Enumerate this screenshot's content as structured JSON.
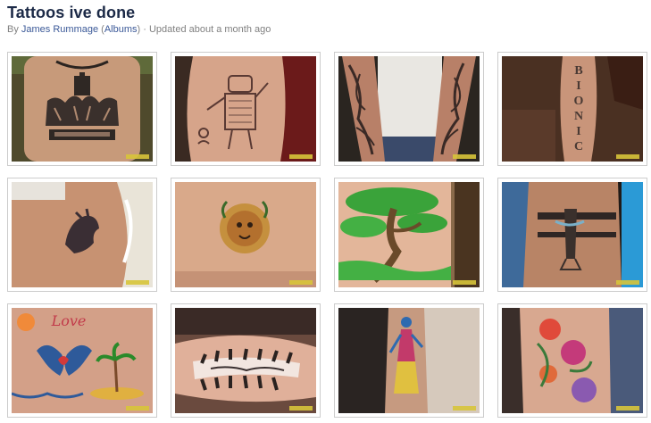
{
  "album": {
    "title": "Tattoos ive done",
    "by_prefix": "By",
    "author": "James Rummage",
    "paren_open": "(",
    "albums_link": "Albums",
    "paren_close": ")",
    "updated": " · Updated about a month ago"
  },
  "photos": [
    {
      "subject": "crown-tattoo-on-upper-back",
      "date_stamp": "05/18/2007"
    },
    {
      "subject": "robot-figure-tattoo-on-arm",
      "date_stamp": "06/18/2007"
    },
    {
      "subject": "forearm-sleeve-tattoos",
      "date_stamp": "06/17/2007"
    },
    {
      "subject": "bionic-lettering-tattoo-on-arm",
      "date_stamp": "05/18/2007",
      "visible_text": "BIONIC"
    },
    {
      "subject": "horse-head-tattoo-on-shoulder",
      "date_stamp": "05/21/2007"
    },
    {
      "subject": "lion-portrait-tattoo-on-lower-back",
      "date_stamp": "06/03/2007"
    },
    {
      "subject": "bonsai-tree-tattoo-on-leg",
      "date_stamp": "10/12/2007"
    },
    {
      "subject": "tribal-armband-tattoo",
      "date_stamp": "10/12/2007"
    },
    {
      "subject": "dolphins-island-love-tattoo",
      "date_stamp": "06/15/2007",
      "visible_text": "Love"
    },
    {
      "subject": "ripped-skin-lettering-tattoo-on-forearm",
      "date_stamp": "10/12/2007"
    },
    {
      "subject": "colorful-figure-tattoo-on-calf",
      "date_stamp": "10/12/2007"
    },
    {
      "subject": "floral-koi-tattoo-on-calf",
      "date_stamp": "10/12/2007"
    }
  ],
  "colors": {
    "title": "#1c2a47",
    "link": "#3b5998",
    "meta": "#808080",
    "thumb_border": "#cccccc"
  }
}
